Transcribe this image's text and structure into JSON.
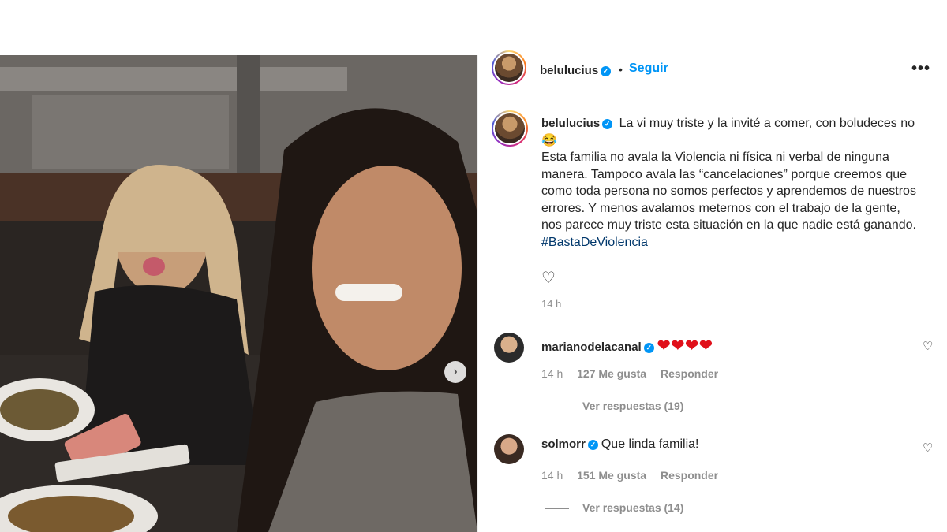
{
  "post": {
    "author": "belulucius",
    "follow_label": "Seguir",
    "separator": "•",
    "more_icon": "more-horizontal-icon",
    "caption_line1": "La vi muy triste y la invité a comer, con boludeces no 😂",
    "caption_body": "Esta familia no avala la Violencia ni física ni verbal de ninguna manera. Tampoco avala las “cancelaciones” porque creemos que como toda persona no somos perfectos y aprendemos de nuestros errores. Y menos avalamos meternos con el trabajo de la gente, nos parece muy triste esta situación en la que nadie está ganando.",
    "hashtag": "#BastaDeViolencia",
    "time": "14 h",
    "like_icon": "heart-outline-icon"
  },
  "comments": [
    {
      "username": "marianodelacanal",
      "text": "❤❤❤❤",
      "time": "14 h",
      "likes": "127 Me gusta",
      "reply_label": "Responder",
      "view_replies": "Ver respuestas (19)"
    },
    {
      "username": "solmorr",
      "text": "Que linda familia!",
      "time": "14 h",
      "likes": "151 Me gusta",
      "reply_label": "Responder",
      "view_replies": "Ver respuestas (14)"
    }
  ],
  "carousel": {
    "next_icon": "chevron-right-icon",
    "next_glyph": "›"
  },
  "colors": {
    "accent": "#0095f6",
    "hashtag": "#00376b",
    "muted": "#8e8e8e",
    "heart": "#e0101a"
  }
}
